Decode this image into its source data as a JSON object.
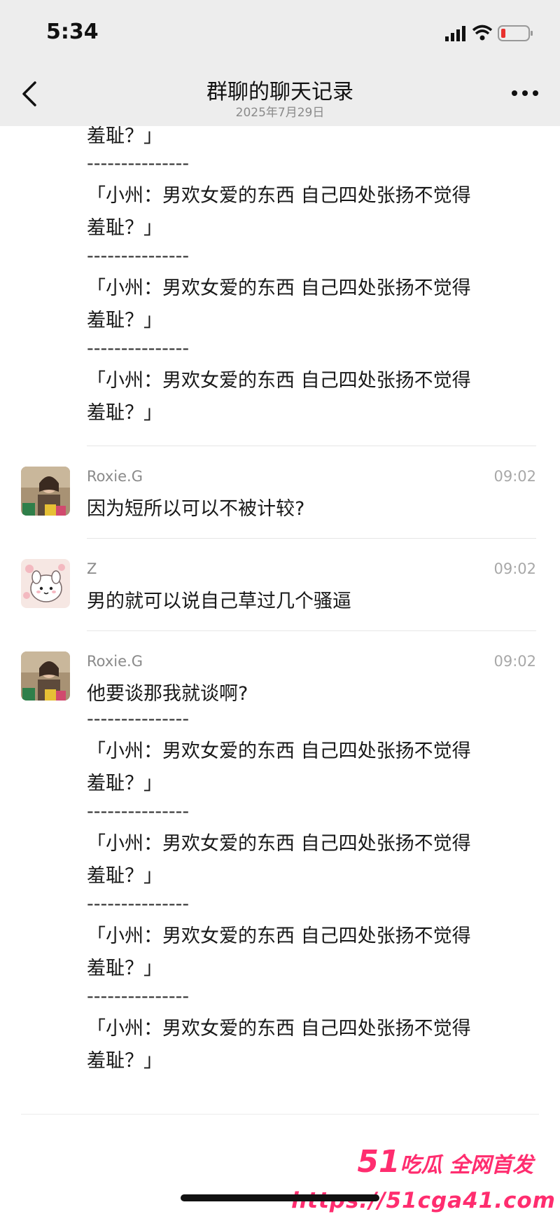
{
  "status_bar": {
    "time": "5:34"
  },
  "nav": {
    "title": "群聊的聊天记录",
    "subtitle": "2025年7月29日"
  },
  "separator": "---------------",
  "quote_line1": "「小州：男欢女爱的东西 自己四处张扬不觉得",
  "quote_line2": "羞耻？」",
  "messages": [
    {
      "sender": "Roxie.G",
      "time": "09:02",
      "text": "因为短所以可以不被计较?"
    },
    {
      "sender": "Z",
      "time": "09:02",
      "text": "男的就可以说自己草过几个骚逼"
    },
    {
      "sender": "Roxie.G",
      "time": "09:02",
      "text": "他要谈那我就谈啊?"
    }
  ],
  "watermark": {
    "brand_number": "51",
    "brand_text": "吃瓜 全网首发",
    "url": "https://51cga41.com"
  },
  "colors": {
    "nav_bg": "#ededed",
    "watermark": "#ff2d6f"
  }
}
